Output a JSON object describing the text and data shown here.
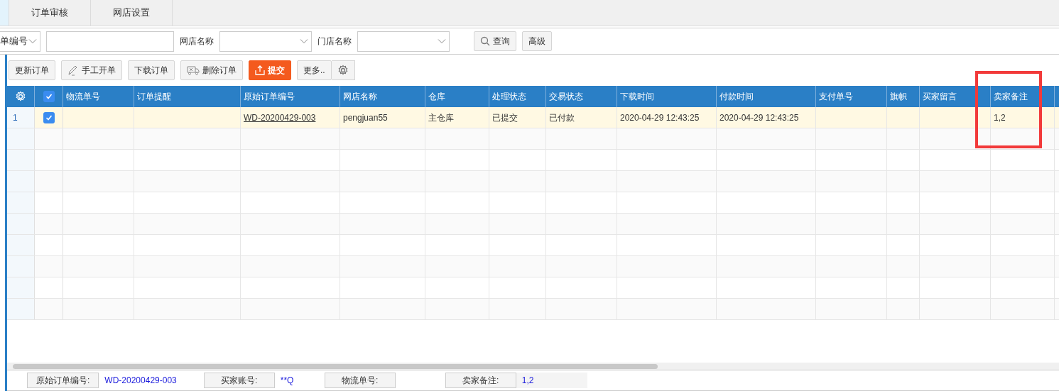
{
  "tabs": [
    {
      "selected": true
    },
    {
      "label": "订单审核",
      "selected": false
    },
    {
      "label": "网店设置",
      "selected": false
    }
  ],
  "filters": [
    {
      "kind": "select",
      "value": "单编号"
    },
    {
      "kind": "input"
    },
    {
      "kind": "label",
      "text": "网店名称"
    },
    {
      "kind": "select"
    },
    {
      "kind": "label",
      "text": "门店名称"
    },
    {
      "kind": "select"
    }
  ],
  "search_buttons": [
    {
      "label": "查询"
    },
    {
      "label": "高级"
    }
  ],
  "toolbar": [
    {
      "label": "更新订单",
      "primary": false
    },
    {
      "label": "手工开单",
      "primary": false
    },
    {
      "label": "下载订单",
      "primary": false
    },
    {
      "label": "删除订单",
      "primary": false
    },
    {
      "label": "提交",
      "primary": true
    },
    {
      "label": "更多..",
      "primary": false
    }
  ],
  "table": {
    "header_checked": true,
    "columns": [
      "物流单号",
      "订单提醒",
      "原始订单编号",
      "网店名称",
      "仓库",
      "处理状态",
      "交易状态",
      "下载时间",
      "付款时间",
      "支付单号",
      "旗帜",
      "买家留言",
      "卖家备注"
    ],
    "rows": [
      {
        "number": "1",
        "checked": true,
        "selected": true,
        "cells": [
          "",
          "",
          "WD-20200429-003",
          "pengjuan55",
          "主仓库",
          "已提交",
          "已付款",
          "2020-04-29 12:43:25",
          "2020-04-29 12:43:25",
          "",
          "",
          "",
          "1,2"
        ]
      }
    ]
  },
  "details": [
    {
      "label": "原始订单编号:",
      "value": "WD-20200429-003"
    },
    {
      "label": "买家账号:",
      "value": "**Q"
    },
    {
      "label": "物流单号:"
    },
    {
      "label": "卖家备注:",
      "value": "1,2"
    }
  ]
}
